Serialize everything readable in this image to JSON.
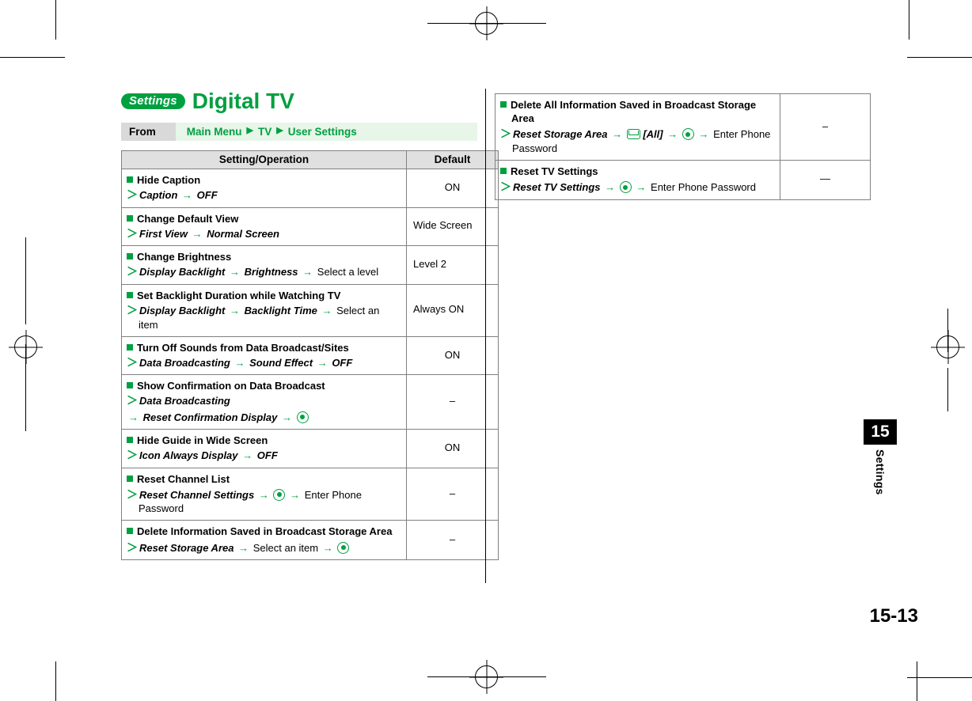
{
  "header": {
    "badge": "Settings",
    "title": "Digital TV"
  },
  "from_bar": {
    "label": "From",
    "path_items": [
      "Main Menu",
      "TV",
      "User Settings"
    ]
  },
  "table_headers": {
    "operation": "Setting/Operation",
    "default": "Default"
  },
  "left_rows": [
    {
      "heading": "Hide Caption",
      "steps": [
        [
          {
            "t": "bi",
            "v": "Caption"
          },
          {
            "t": "arrow"
          },
          {
            "t": "bi",
            "v": "OFF"
          }
        ]
      ],
      "default": "ON"
    },
    {
      "heading": "Change Default View",
      "steps": [
        [
          {
            "t": "bi",
            "v": "First View"
          },
          {
            "t": "arrow"
          },
          {
            "t": "bi",
            "v": "Normal Screen"
          }
        ]
      ],
      "default": "Wide Screen"
    },
    {
      "heading": "Change Brightness",
      "steps": [
        [
          {
            "t": "bi",
            "v": "Display Backlight"
          },
          {
            "t": "arrow"
          },
          {
            "t": "bi",
            "v": "Brightness"
          },
          {
            "t": "arrow"
          },
          {
            "t": "txt",
            "v": "Select a level"
          }
        ]
      ],
      "default": "Level 2"
    },
    {
      "heading": "Set Backlight Duration while Watching TV",
      "steps": [
        [
          {
            "t": "bi",
            "v": "Display Backlight"
          },
          {
            "t": "arrow"
          },
          {
            "t": "bi",
            "v": "Backlight Time"
          },
          {
            "t": "arrow"
          },
          {
            "t": "txt",
            "v": "Select an item"
          }
        ]
      ],
      "default": "Always ON"
    },
    {
      "heading": "Turn Off Sounds from Data Broadcast/Sites",
      "steps": [
        [
          {
            "t": "bi",
            "v": "Data Broadcasting"
          },
          {
            "t": "arrow"
          },
          {
            "t": "bi",
            "v": "Sound Effect"
          },
          {
            "t": "arrow"
          },
          {
            "t": "bi",
            "v": "OFF"
          }
        ]
      ],
      "default": "ON"
    },
    {
      "heading": "Show Confirmation on Data Broadcast",
      "steps": [
        [
          {
            "t": "bi",
            "v": "Data Broadcasting"
          }
        ],
        [
          {
            "t": "arrow"
          },
          {
            "t": "bi",
            "v": "Reset Confirmation Display"
          },
          {
            "t": "arrow"
          },
          {
            "t": "ok"
          }
        ]
      ],
      "default": "–"
    },
    {
      "heading": "Hide Guide in Wide Screen",
      "steps": [
        [
          {
            "t": "bi",
            "v": "Icon Always Display"
          },
          {
            "t": "arrow"
          },
          {
            "t": "bi",
            "v": "OFF"
          }
        ]
      ],
      "default": "ON"
    },
    {
      "heading": "Reset Channel List",
      "steps": [
        [
          {
            "t": "bi",
            "v": "Reset Channel Settings"
          },
          {
            "t": "arrow"
          },
          {
            "t": "ok"
          },
          {
            "t": "arrow"
          },
          {
            "t": "txt",
            "v": "Enter Phone Password"
          }
        ]
      ],
      "default": "–"
    },
    {
      "heading": "Delete Information Saved in Broadcast Storage Area",
      "steps": [
        [
          {
            "t": "bi",
            "v": "Reset Storage Area"
          },
          {
            "t": "arrow"
          },
          {
            "t": "txt",
            "v": "Select an item"
          },
          {
            "t": "arrow"
          },
          {
            "t": "ok"
          }
        ]
      ],
      "default": "–"
    }
  ],
  "right_rows": [
    {
      "heading": "Delete All Information Saved in Broadcast Storage Area",
      "steps": [
        [
          {
            "t": "bi",
            "v": "Reset Storage Area"
          },
          {
            "t": "arrow"
          },
          {
            "t": "mail"
          },
          {
            "t": "bi",
            "v": "[All]"
          },
          {
            "t": "arrow"
          },
          {
            "t": "ok"
          },
          {
            "t": "arrow"
          },
          {
            "t": "txt",
            "v": "Enter Phone Password"
          }
        ]
      ],
      "default": "–"
    },
    {
      "heading": "Reset TV Settings",
      "steps": [
        [
          {
            "t": "bi",
            "v": "Reset TV Settings"
          },
          {
            "t": "arrow"
          },
          {
            "t": "ok"
          },
          {
            "t": "arrow"
          },
          {
            "t": "txt",
            "v": "Enter Phone Password"
          }
        ]
      ],
      "default": "—"
    }
  ],
  "chapter_tab": {
    "number": "15",
    "label": "Settings"
  },
  "page_number": "15-13"
}
